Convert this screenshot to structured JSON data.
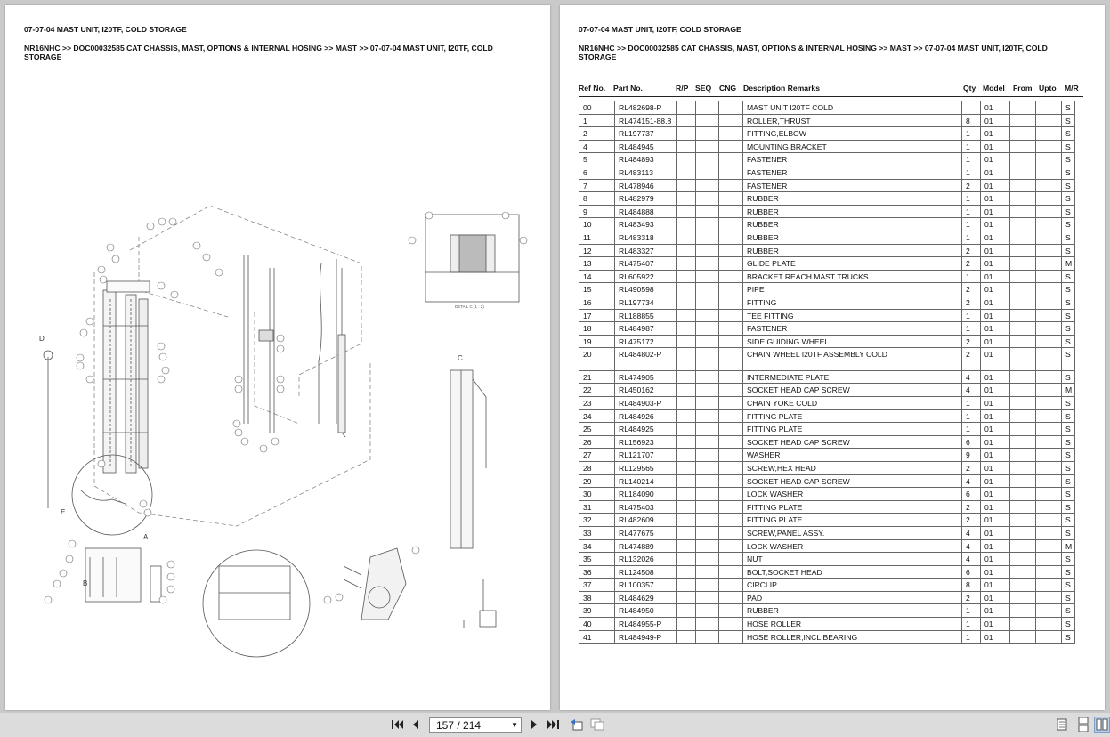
{
  "header": {
    "title": "07-07-04 MAST UNIT, I20TF, COLD STORAGE",
    "breadcrumb_line1": "NR16NHC >> DOC00032585 CAT CHASSIS, MAST, OPTIONS & INTERNAL HOSING >> MAST >> 07-07-04 MAST UNIT, I20TF, COLD",
    "breadcrumb_line2": "STORAGE"
  },
  "drawing_labels": {
    "detail_d": "D",
    "detail_e": "E",
    "detail_a": "A",
    "detail_b": "B",
    "detail_c": "C",
    "section_caption": "DETAIL C (1 : 2)"
  },
  "columns": [
    "Ref No.",
    "Part No.",
    "R/P",
    "SEQ",
    "CNG",
    "Description Remarks",
    "Qty",
    "Model",
    "From",
    "Upto",
    "M/R"
  ],
  "parts": [
    {
      "ref": "00",
      "part": "RL482698-P",
      "desc": "MAST UNIT I20TF COLD",
      "qty": "",
      "model": "01",
      "mr": "S"
    },
    {
      "ref": "1",
      "part": "RL474151-88.8",
      "desc": "ROLLER,THRUST",
      "qty": "8",
      "model": "01",
      "mr": "S"
    },
    {
      "ref": "2",
      "part": "RL197737",
      "desc": "FITTING,ELBOW",
      "qty": "1",
      "model": "01",
      "mr": "S"
    },
    {
      "ref": "4",
      "part": "RL484945",
      "desc": "MOUNTING BRACKET",
      "qty": "1",
      "model": "01",
      "mr": "S"
    },
    {
      "ref": "5",
      "part": "RL484893",
      "desc": "FASTENER",
      "qty": "1",
      "model": "01",
      "mr": "S"
    },
    {
      "ref": "6",
      "part": "RL483113",
      "desc": "FASTENER",
      "qty": "1",
      "model": "01",
      "mr": "S"
    },
    {
      "ref": "7",
      "part": "RL478946",
      "desc": "FASTENER",
      "qty": "2",
      "model": "01",
      "mr": "S"
    },
    {
      "ref": "8",
      "part": "RL482979",
      "desc": "RUBBER",
      "qty": "1",
      "model": "01",
      "mr": "S"
    },
    {
      "ref": "9",
      "part": "RL484888",
      "desc": "RUBBER",
      "qty": "1",
      "model": "01",
      "mr": "S"
    },
    {
      "ref": "10",
      "part": "RL483493",
      "desc": "RUBBER",
      "qty": "1",
      "model": "01",
      "mr": "S"
    },
    {
      "ref": "11",
      "part": "RL483318",
      "desc": "RUBBER",
      "qty": "1",
      "model": "01",
      "mr": "S"
    },
    {
      "ref": "12",
      "part": "RL483327",
      "desc": "RUBBER",
      "qty": "2",
      "model": "01",
      "mr": "S"
    },
    {
      "ref": "13",
      "part": "RL475407",
      "desc": "GLIDE PLATE",
      "qty": "2",
      "model": "01",
      "mr": "M"
    },
    {
      "ref": "14",
      "part": "RL605922",
      "desc": "BRACKET REACH MAST TRUCKS",
      "qty": "1",
      "model": "01",
      "mr": "S"
    },
    {
      "ref": "15",
      "part": "RL490598",
      "desc": "PIPE",
      "qty": "2",
      "model": "01",
      "mr": "S"
    },
    {
      "ref": "16",
      "part": "RL197734",
      "desc": "FITTING",
      "qty": "2",
      "model": "01",
      "mr": "S"
    },
    {
      "ref": "17",
      "part": "RL188855",
      "desc": "TEE FITTING",
      "qty": "1",
      "model": "01",
      "mr": "S"
    },
    {
      "ref": "18",
      "part": "RL484987",
      "desc": "FASTENER",
      "qty": "1",
      "model": "01",
      "mr": "S"
    },
    {
      "ref": "19",
      "part": "RL475172",
      "desc": "SIDE GUIDING WHEEL",
      "qty": "2",
      "model": "01",
      "mr": "S"
    },
    {
      "ref": "20",
      "part": "RL484802-P",
      "desc": "CHAIN WHEEL I20TF ASSEMBLY COLD",
      "qty": "2",
      "model": "01",
      "mr": "S",
      "tall": true
    },
    {
      "ref": "21",
      "part": "RL474905",
      "desc": "INTERMEDIATE PLATE",
      "qty": "4",
      "model": "01",
      "mr": "S"
    },
    {
      "ref": "22",
      "part": "RL450162",
      "desc": "SOCKET HEAD CAP SCREW",
      "qty": "4",
      "model": "01",
      "mr": "M"
    },
    {
      "ref": "23",
      "part": "RL484903-P",
      "desc": "CHAIN YOKE COLD",
      "qty": "1",
      "model": "01",
      "mr": "S"
    },
    {
      "ref": "24",
      "part": "RL484926",
      "desc": "FITTING PLATE",
      "qty": "1",
      "model": "01",
      "mr": "S"
    },
    {
      "ref": "25",
      "part": "RL484925",
      "desc": "FITTING PLATE",
      "qty": "1",
      "model": "01",
      "mr": "S"
    },
    {
      "ref": "26",
      "part": "RL156923",
      "desc": "SOCKET HEAD CAP SCREW",
      "qty": "6",
      "model": "01",
      "mr": "S"
    },
    {
      "ref": "27",
      "part": "RL121707",
      "desc": "WASHER",
      "qty": "9",
      "model": "01",
      "mr": "S"
    },
    {
      "ref": "28",
      "part": "RL129565",
      "desc": "SCREW,HEX HEAD",
      "qty": "2",
      "model": "01",
      "mr": "S"
    },
    {
      "ref": "29",
      "part": "RL140214",
      "desc": "SOCKET HEAD CAP SCREW",
      "qty": "4",
      "model": "01",
      "mr": "S"
    },
    {
      "ref": "30",
      "part": "RL184090",
      "desc": "LOCK WASHER",
      "qty": "6",
      "model": "01",
      "mr": "S"
    },
    {
      "ref": "31",
      "part": "RL475403",
      "desc": "FITTING PLATE",
      "qty": "2",
      "model": "01",
      "mr": "S"
    },
    {
      "ref": "32",
      "part": "RL482609",
      "desc": "FITTING PLATE",
      "qty": "2",
      "model": "01",
      "mr": "S"
    },
    {
      "ref": "33",
      "part": "RL477675",
      "desc": "SCREW,PANEL ASSY.",
      "qty": "4",
      "model": "01",
      "mr": "S"
    },
    {
      "ref": "34",
      "part": "RL474889",
      "desc": "LOCK WASHER",
      "qty": "4",
      "model": "01",
      "mr": "M"
    },
    {
      "ref": "35",
      "part": "RL132026",
      "desc": "NUT",
      "qty": "4",
      "model": "01",
      "mr": "S"
    },
    {
      "ref": "36",
      "part": "RL124508",
      "desc": "BOLT,SOCKET HEAD",
      "qty": "6",
      "model": "01",
      "mr": "S"
    },
    {
      "ref": "37",
      "part": "RL100357",
      "desc": "CIRCLIP",
      "qty": "8",
      "model": "01",
      "mr": "S"
    },
    {
      "ref": "38",
      "part": "RL484629",
      "desc": "PAD",
      "qty": "2",
      "model": "01",
      "mr": "S"
    },
    {
      "ref": "39",
      "part": "RL484950",
      "desc": "RUBBER",
      "qty": "1",
      "model": "01",
      "mr": "S"
    },
    {
      "ref": "40",
      "part": "RL484955-P",
      "desc": "HOSE ROLLER",
      "qty": "1",
      "model": "01",
      "mr": "S"
    },
    {
      "ref": "41",
      "part": "RL484949-P",
      "desc": "HOSE ROLLER,INCL.BEARING",
      "qty": "1",
      "model": "01",
      "mr": "S"
    }
  ],
  "toolbar": {
    "page_value": "157 / 214",
    "icons": [
      "first-page-icon",
      "prev-page-icon",
      "next-page-icon",
      "last-page-icon",
      "prev-view-icon",
      "next-view-icon",
      "single-page-icon",
      "continuous-icon",
      "two-page-icon"
    ]
  }
}
